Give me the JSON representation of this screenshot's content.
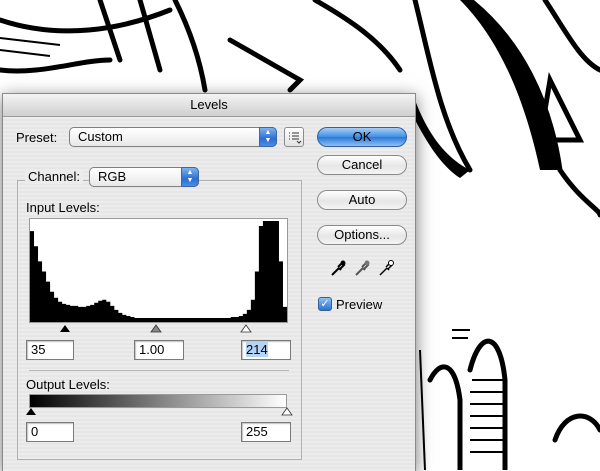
{
  "window": {
    "title": "Levels"
  },
  "preset": {
    "label": "Preset:",
    "value": "Custom",
    "menu_icon": "list-menu-icon"
  },
  "channel": {
    "label": "Channel:",
    "value": "RGB"
  },
  "input_levels": {
    "label": "Input Levels:",
    "black": "35",
    "gamma": "1.00",
    "white": "214",
    "histogram": [
      0.9,
      0.75,
      0.6,
      0.5,
      0.4,
      0.3,
      0.24,
      0.2,
      0.18,
      0.17,
      0.16,
      0.16,
      0.15,
      0.15,
      0.16,
      0.17,
      0.19,
      0.21,
      0.22,
      0.2,
      0.16,
      0.12,
      0.09,
      0.07,
      0.06,
      0.05,
      0.04,
      0.04,
      0.04,
      0.04,
      0.04,
      0.04,
      0.04,
      0.04,
      0.04,
      0.04,
      0.04,
      0.04,
      0.04,
      0.04,
      0.04,
      0.04,
      0.04,
      0.04,
      0.04,
      0.04,
      0.04,
      0.04,
      0.04,
      0.04,
      0.05,
      0.05,
      0.06,
      0.08,
      0.12,
      0.22,
      0.5,
      0.95,
      1,
      1,
      1,
      1,
      0.6,
      0.15
    ]
  },
  "output_levels": {
    "label": "Output Levels:",
    "black": "0",
    "white": "255"
  },
  "buttons": {
    "ok": "OK",
    "cancel": "Cancel",
    "auto": "Auto",
    "options": "Options..."
  },
  "eyedroppers": [
    "black-eyedropper-icon",
    "gray-eyedropper-icon",
    "white-eyedropper-icon"
  ],
  "preview": {
    "label": "Preview",
    "checked": true
  }
}
